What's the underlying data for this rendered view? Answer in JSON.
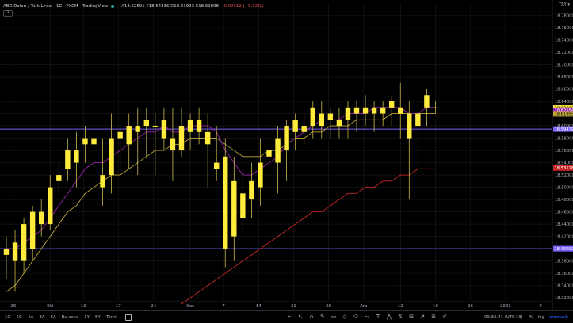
{
  "header": {
    "symbol": "ABD Doları / Türk Lirası · 1G · FXCM · TradingView",
    "o_label": "A",
    "o": "18.62591",
    "h_label": "Y",
    "h": "18.64336",
    "l_label": "D",
    "l": "18.61923",
    "c_label": "K",
    "c": "18.62898",
    "change": "−0.02312 (−0.12%)",
    "indicator_badge": "3"
  },
  "currency": "TRY ▾",
  "bottombar": {
    "ranges": [
      "1G",
      "5G",
      "1A",
      "3A",
      "6A",
      "Bu sene",
      "1Y",
      "5Y",
      "Tümü"
    ],
    "clock": "09:33:41 (UTC+3)",
    "opts": [
      "%",
      "log",
      "otomatik"
    ]
  },
  "colors": {
    "bull": "#ffeb3b",
    "wick": "#c9b94a",
    "ma_fast": "#9c27b0",
    "ma_mid": "#c0a83a",
    "ma_slow": "#c62828",
    "hline": "#7b61ff",
    "grid": "#1a1a1a"
  },
  "chart_data": {
    "type": "candlestick",
    "y_axis_ticks": [
      "18.78000",
      "18.76000",
      "18.74000",
      "18.72000",
      "18.70000",
      "18.68000",
      "18.66000",
      "18.64000",
      "18.62000",
      "18.60000",
      "18.58000",
      "18.56000",
      "18.54000",
      "18.52000",
      "18.50000",
      "18.48000",
      "18.46000",
      "18.44000",
      "18.42000",
      "18.40000",
      "18.38000",
      "18.36000",
      "18.34000",
      "18.32000"
    ],
    "x_axis_ticks": [
      "26",
      "Eki",
      "10",
      "17",
      "24",
      "Kas",
      "7",
      "14",
      "21",
      "28",
      "Ara",
      "12",
      "19",
      "26",
      "2023",
      "9"
    ],
    "ylim": [
      18.315,
      18.8
    ],
    "price_labels": [
      {
        "value": 18.62898,
        "text": "18.62898",
        "bg": "#ffeb3b",
        "fg": "#000"
      },
      {
        "value": 18.6255,
        "text": "18.62554",
        "bg": "#9c27b0",
        "fg": "#fff"
      },
      {
        "value": 18.6195,
        "text": "18.61955",
        "bg": "#c0a83a",
        "fg": "#000"
      },
      {
        "value": 18.5948,
        "text": "18.59479",
        "bg": "#7b61ff",
        "fg": "#fff"
      },
      {
        "value": 18.5313,
        "text": "18.53128",
        "bg": "#c62828",
        "fg": "#fff"
      },
      {
        "value": 18.4,
        "text": "18.40000",
        "bg": "#7b61ff",
        "fg": "#fff"
      }
    ],
    "hlines": [
      18.5948,
      18.4
    ],
    "candles": [
      {
        "o": 18.39,
        "h": 18.42,
        "l": 18.35,
        "c": 18.4
      },
      {
        "o": 18.38,
        "h": 18.43,
        "l": 18.33,
        "c": 18.41
      },
      {
        "o": 18.38,
        "h": 18.45,
        "l": 18.36,
        "c": 18.44
      },
      {
        "o": 18.4,
        "h": 18.47,
        "l": 18.38,
        "c": 18.46
      },
      {
        "o": 18.46,
        "h": 18.48,
        "l": 18.42,
        "c": 18.44
      },
      {
        "o": 18.44,
        "h": 18.52,
        "l": 18.43,
        "c": 18.5
      },
      {
        "o": 18.51,
        "h": 18.54,
        "l": 18.49,
        "c": 18.52
      },
      {
        "o": 18.53,
        "h": 18.58,
        "l": 18.51,
        "c": 18.56
      },
      {
        "o": 18.54,
        "h": 18.59,
        "l": 18.5,
        "c": 18.56
      },
      {
        "o": 18.57,
        "h": 18.6,
        "l": 18.54,
        "c": 18.58
      },
      {
        "o": 18.57,
        "h": 18.62,
        "l": 18.49,
        "c": 18.58
      },
      {
        "o": 18.5,
        "h": 18.58,
        "l": 18.47,
        "c": 18.52
      },
      {
        "o": 18.52,
        "h": 18.62,
        "l": 18.49,
        "c": 18.58
      },
      {
        "o": 18.58,
        "h": 18.6,
        "l": 18.53,
        "c": 18.59
      },
      {
        "o": 18.57,
        "h": 18.62,
        "l": 18.53,
        "c": 18.6
      },
      {
        "o": 18.59,
        "h": 18.63,
        "l": 18.52,
        "c": 18.6
      },
      {
        "o": 18.6,
        "h": 18.63,
        "l": 18.55,
        "c": 18.61
      },
      {
        "o": 18.6,
        "h": 18.62,
        "l": 18.52,
        "c": 18.6
      },
      {
        "o": 18.58,
        "h": 18.63,
        "l": 18.56,
        "c": 18.61
      },
      {
        "o": 18.56,
        "h": 18.63,
        "l": 18.51,
        "c": 18.58
      },
      {
        "o": 18.56,
        "h": 18.63,
        "l": 18.55,
        "c": 18.6
      },
      {
        "o": 18.59,
        "h": 18.62,
        "l": 18.56,
        "c": 18.61
      },
      {
        "o": 18.59,
        "h": 18.63,
        "l": 18.57,
        "c": 18.61
      },
      {
        "o": 18.57,
        "h": 18.62,
        "l": 18.5,
        "c": 18.59
      },
      {
        "o": 18.53,
        "h": 18.6,
        "l": 18.51,
        "c": 18.54
      },
      {
        "o": 18.4,
        "h": 18.58,
        "l": 18.37,
        "c": 18.55
      },
      {
        "o": 18.42,
        "h": 18.55,
        "l": 18.38,
        "c": 18.51
      },
      {
        "o": 18.45,
        "h": 18.53,
        "l": 18.42,
        "c": 18.49
      },
      {
        "o": 18.48,
        "h": 18.54,
        "l": 18.45,
        "c": 18.51
      },
      {
        "o": 18.5,
        "h": 18.58,
        "l": 18.47,
        "c": 18.54
      },
      {
        "o": 18.55,
        "h": 18.59,
        "l": 18.52,
        "c": 18.56
      },
      {
        "o": 18.54,
        "h": 18.6,
        "l": 18.49,
        "c": 18.58
      },
      {
        "o": 18.56,
        "h": 18.61,
        "l": 18.51,
        "c": 18.6
      },
      {
        "o": 18.59,
        "h": 18.62,
        "l": 18.56,
        "c": 18.61
      },
      {
        "o": 18.59,
        "h": 18.62,
        "l": 18.57,
        "c": 18.6
      },
      {
        "o": 18.6,
        "h": 18.64,
        "l": 18.58,
        "c": 18.63
      },
      {
        "o": 18.6,
        "h": 18.64,
        "l": 18.58,
        "c": 18.62
      },
      {
        "o": 18.61,
        "h": 18.63,
        "l": 18.58,
        "c": 18.62
      },
      {
        "o": 18.6,
        "h": 18.63,
        "l": 18.58,
        "c": 18.61
      },
      {
        "o": 18.61,
        "h": 18.64,
        "l": 18.58,
        "c": 18.63
      },
      {
        "o": 18.62,
        "h": 18.64,
        "l": 18.59,
        "c": 18.63
      },
      {
        "o": 18.62,
        "h": 18.65,
        "l": 18.6,
        "c": 18.63
      },
      {
        "o": 18.62,
        "h": 18.64,
        "l": 18.59,
        "c": 18.63
      },
      {
        "o": 18.62,
        "h": 18.64,
        "l": 18.6,
        "c": 18.63
      },
      {
        "o": 18.63,
        "h": 18.65,
        "l": 18.6,
        "c": 18.64
      },
      {
        "o": 18.62,
        "h": 18.67,
        "l": 18.58,
        "c": 18.63
      },
      {
        "o": 18.58,
        "h": 18.64,
        "l": 18.48,
        "c": 18.62
      },
      {
        "o": 18.6,
        "h": 18.64,
        "l": 18.52,
        "c": 18.62
      },
      {
        "o": 18.63,
        "h": 18.66,
        "l": 18.6,
        "c": 18.65
      },
      {
        "o": 18.63,
        "h": 18.64,
        "l": 18.62,
        "c": 18.63
      }
    ],
    "ma_fast": [
      18.4,
      18.4,
      18.41,
      18.42,
      18.43,
      18.45,
      18.47,
      18.49,
      18.51,
      18.53,
      18.54,
      18.54,
      18.55,
      18.56,
      18.57,
      18.58,
      18.59,
      18.59,
      18.6,
      18.59,
      18.59,
      18.6,
      18.6,
      18.6,
      18.59,
      18.56,
      18.54,
      18.52,
      18.52,
      18.53,
      18.54,
      18.55,
      18.57,
      18.58,
      18.59,
      18.6,
      18.61,
      18.61,
      18.61,
      18.62,
      18.62,
      18.62,
      18.63,
      18.63,
      18.63,
      18.63,
      18.62,
      18.62,
      18.63,
      18.63
    ],
    "ma_mid": [
      18.33,
      18.34,
      18.36,
      18.38,
      18.4,
      18.42,
      18.44,
      18.46,
      18.47,
      18.49,
      18.5,
      18.51,
      18.52,
      18.52,
      18.53,
      18.54,
      18.55,
      18.56,
      18.56,
      18.57,
      18.57,
      18.58,
      18.58,
      18.58,
      18.58,
      18.57,
      18.56,
      18.55,
      18.55,
      18.55,
      18.56,
      18.56,
      18.57,
      18.58,
      18.58,
      18.59,
      18.59,
      18.6,
      18.6,
      18.6,
      18.61,
      18.61,
      18.61,
      18.61,
      18.62,
      18.62,
      18.62,
      18.62,
      18.62,
      18.62
    ],
    "ma_slow": [
      null,
      null,
      null,
      null,
      null,
      null,
      null,
      null,
      null,
      null,
      null,
      null,
      null,
      null,
      null,
      null,
      null,
      null,
      null,
      null,
      18.31,
      18.32,
      18.33,
      18.34,
      18.35,
      18.36,
      18.37,
      18.38,
      18.39,
      18.4,
      18.41,
      18.42,
      18.43,
      18.44,
      18.45,
      18.46,
      18.46,
      18.47,
      18.48,
      18.49,
      18.49,
      18.5,
      18.5,
      18.51,
      18.51,
      18.52,
      18.52,
      18.53,
      18.53,
      18.53
    ]
  }
}
